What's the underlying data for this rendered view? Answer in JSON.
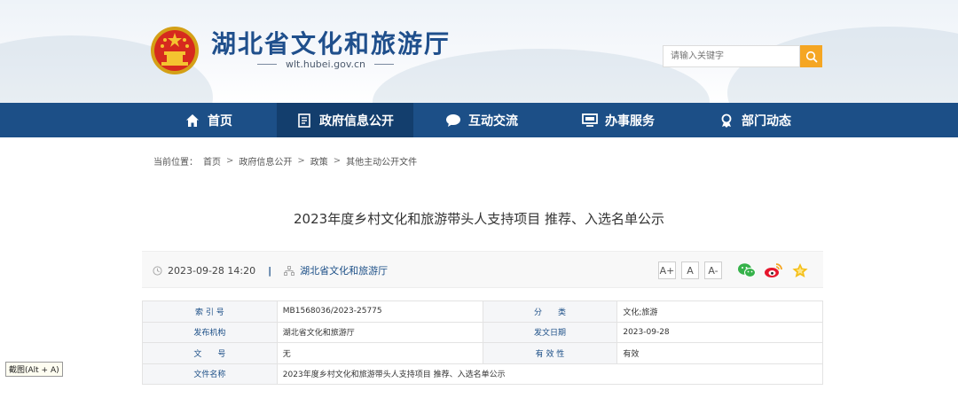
{
  "header": {
    "site_title": "湖北省文化和旅游厅",
    "site_url": "wlt.hubei.gov.cn",
    "search_placeholder": "请输入关键字"
  },
  "nav": {
    "items": [
      {
        "label": "首页",
        "icon": "home-icon"
      },
      {
        "label": "政府信息公开",
        "icon": "document-icon"
      },
      {
        "label": "互动交流",
        "icon": "chat-bubble-icon"
      },
      {
        "label": "办事服务",
        "icon": "monitor-icon"
      },
      {
        "label": "部门动态",
        "icon": "award-icon"
      }
    ],
    "active_index": 1
  },
  "breadcrumb": {
    "prefix": "当前位置：",
    "items": [
      "首页",
      "政府信息公开",
      "政策",
      "其他主动公开文件"
    ],
    "sep": ">"
  },
  "article": {
    "title": "2023年度乡村文化和旅游带头人支持项目 推荐、入选名单公示",
    "datetime": "2023-09-28 14:20",
    "divider": "|",
    "source": "湖北省文化和旅游厅",
    "font_buttons": [
      "A+",
      "A",
      "A-"
    ]
  },
  "info_table": {
    "rows": [
      {
        "label1": "索 引 号",
        "value1": "MB1568036/2023-25775",
        "label2": "分　　类",
        "value2": "文化;旅游"
      },
      {
        "label1": "发布机构",
        "value1": "湖北省文化和旅游厅",
        "label2": "发文日期",
        "value2": "2023-09-28"
      },
      {
        "label1": "文　　号",
        "value1": "无",
        "label2": "有 效 性",
        "value2": "有效"
      }
    ],
    "last_row": {
      "label": "文件名称",
      "value": "2023年度乡村文化和旅游带头人支持项目 推荐、入选名单公示"
    }
  },
  "tooltip": {
    "text": "截图(Alt + A)"
  },
  "colors": {
    "nav_bg": "#1c4f87",
    "nav_active": "#133e6d",
    "search_btn": "#f5a623",
    "label_text": "#1c4f87"
  }
}
